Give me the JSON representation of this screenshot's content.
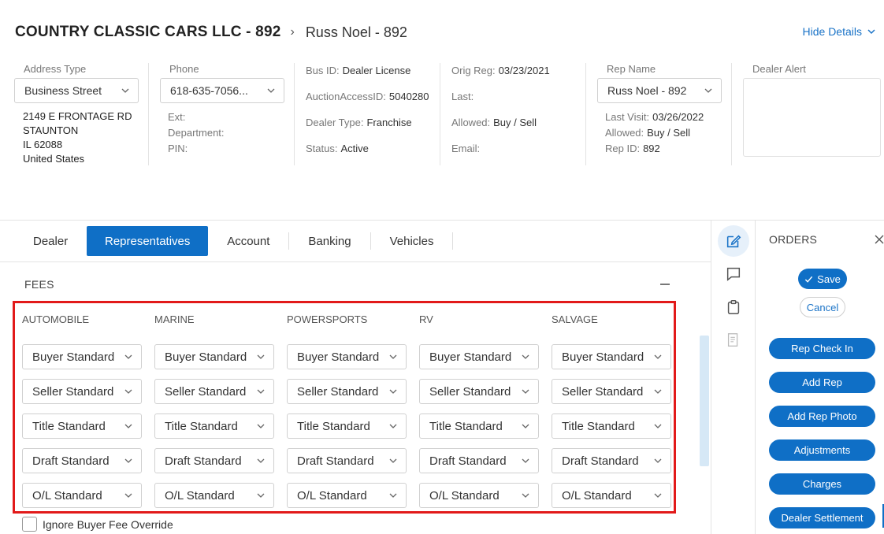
{
  "header": {
    "dealer_title": "COUNTRY CLASSIC CARS LLC - 892",
    "rep_title": "Russ  Noel  - 892",
    "hide_details": "Hide Details"
  },
  "details": {
    "address_type_label": "Address Type",
    "address_type_value": "Business Street",
    "address_lines": [
      "2149 E FRONTAGE RD",
      "STAUNTON",
      "IL 62088",
      "United States"
    ],
    "phone_label": "Phone",
    "phone_value": "618-635-7056...",
    "ext_label": "Ext:",
    "department_label": "Department:",
    "pin_label": "PIN:",
    "bus_id_label": "Bus ID:",
    "bus_id_value": "Dealer License",
    "auction_access_label": "AuctionAccessID:",
    "auction_access_value": "5040280",
    "dealer_type_label": "Dealer Type:",
    "dealer_type_value": "Franchise",
    "status_label": "Status:",
    "status_value": "Active",
    "orig_reg_label": "Orig Reg:",
    "orig_reg_value": "03/23/2021",
    "last_label": "Last:",
    "allowed_label": "Allowed:",
    "allowed_value": "Buy / Sell",
    "email_label": "Email:",
    "rep_name_label": "Rep Name",
    "rep_name_value": "Russ  Noel  - 892",
    "last_visit_label": "Last Visit:",
    "last_visit_value": "03/26/2022",
    "rep_allowed_label": "Allowed:",
    "rep_allowed_value": "Buy / Sell",
    "rep_id_label": "Rep ID:",
    "rep_id_value": "892",
    "dealer_alert_label": "Dealer Alert"
  },
  "tabs": [
    {
      "label": "Dealer",
      "active": false
    },
    {
      "label": "Representatives",
      "active": true
    },
    {
      "label": "Account",
      "active": false
    },
    {
      "label": "Banking",
      "active": false
    },
    {
      "label": "Vehicles",
      "active": false
    }
  ],
  "fees": {
    "title": "FEES",
    "columns": [
      "AUTOMOBILE",
      "MARINE",
      "POWERSPORTS",
      "RV",
      "SALVAGE"
    ],
    "rows": [
      "Buyer Standard",
      "Seller Standard",
      "Title Standard",
      "Draft Standard",
      "O/L Standard"
    ],
    "ignore_override_label": "Ignore Buyer Fee Override"
  },
  "rail_icons": [
    "edit-icon",
    "chat-icon",
    "clipboard-icon",
    "document-icon"
  ],
  "orders": {
    "title": "ORDERS",
    "save_label": "Save",
    "cancel_label": "Cancel",
    "actions": [
      "Rep Check In",
      "Add Rep",
      "Add Rep Photo",
      "Adjustments",
      "Charges",
      "Dealer Settlement"
    ]
  },
  "colors": {
    "accent": "#0f6fc6",
    "highlight_border": "#e21a1a"
  }
}
